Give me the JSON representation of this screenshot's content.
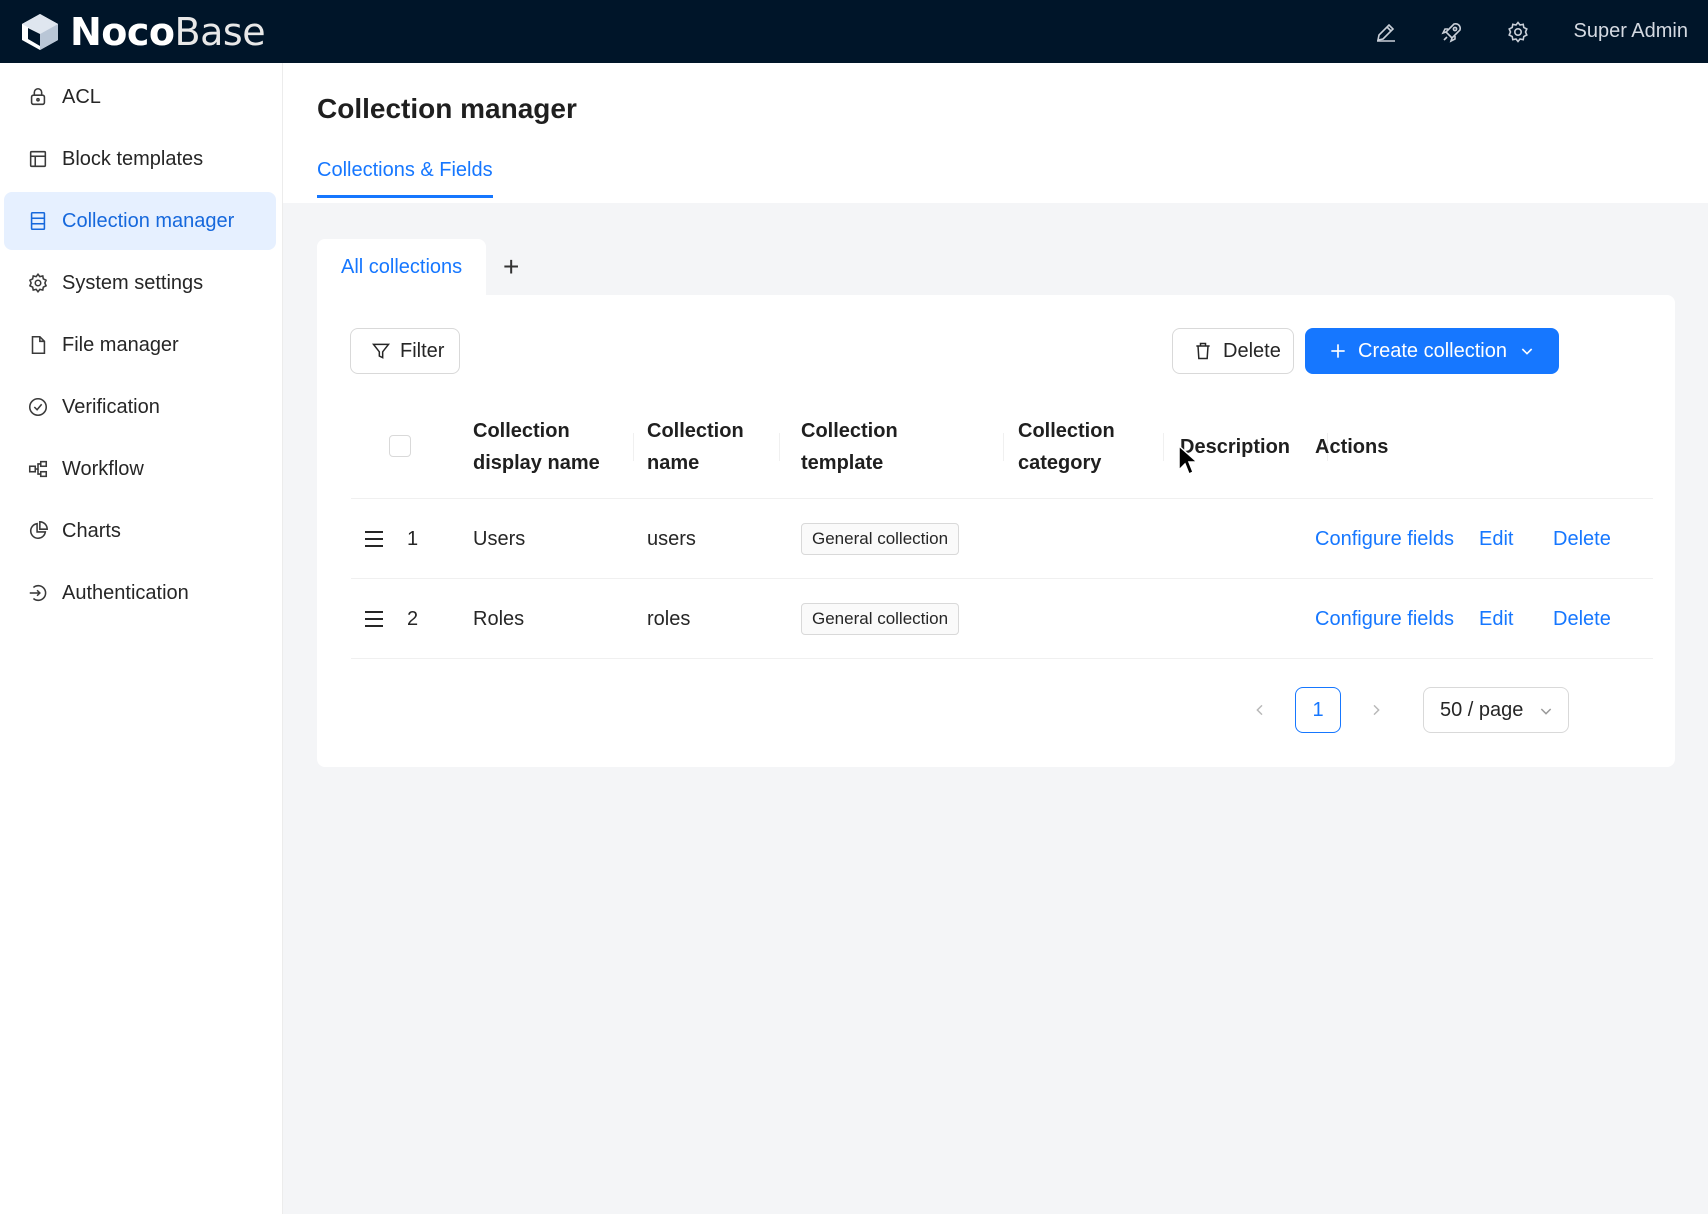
{
  "brand": {
    "bold": "Noco",
    "light": "Base"
  },
  "header": {
    "user": "Super Admin",
    "icons": [
      "design-mode-icon",
      "plugins-rocket-icon",
      "settings-gear-icon"
    ]
  },
  "sidebar": {
    "items": [
      {
        "label": "ACL",
        "icon": "lock-icon"
      },
      {
        "label": "Block templates",
        "icon": "layout-icon"
      },
      {
        "label": "Collection manager",
        "icon": "database-icon",
        "active": true
      },
      {
        "label": "System settings",
        "icon": "gear-icon"
      },
      {
        "label": "File manager",
        "icon": "file-icon"
      },
      {
        "label": "Verification",
        "icon": "check-circle-icon"
      },
      {
        "label": "Workflow",
        "icon": "workflow-icon"
      },
      {
        "label": "Charts",
        "icon": "pie-chart-icon"
      },
      {
        "label": "Authentication",
        "icon": "login-icon"
      }
    ]
  },
  "page": {
    "title": "Collection manager",
    "tab": "Collections & Fields"
  },
  "collection_tabs": {
    "active": "All collections",
    "add": "+"
  },
  "toolbar": {
    "filter": "Filter",
    "delete": "Delete",
    "create": "Create collection"
  },
  "table": {
    "headers": {
      "display_name": [
        "Collection",
        "display name"
      ],
      "name": [
        "Collection",
        "name"
      ],
      "template": [
        "Collection",
        "template"
      ],
      "category": [
        "Collection",
        "category"
      ],
      "description": "Description",
      "actions": "Actions"
    },
    "rows": [
      {
        "index": "1",
        "display_name": "Users",
        "name": "users",
        "template": "General collection",
        "configure": "Configure fields",
        "edit": "Edit",
        "delete": "Delete"
      },
      {
        "index": "2",
        "display_name": "Roles",
        "name": "roles",
        "template": "General collection",
        "configure": "Configure fields",
        "edit": "Edit",
        "delete": "Delete"
      }
    ]
  },
  "pagination": {
    "current": "1",
    "page_size": "50 / page"
  },
  "colors": {
    "primary": "#1677ff",
    "header_bg": "#001529",
    "active_bg": "#e6f0ff"
  }
}
